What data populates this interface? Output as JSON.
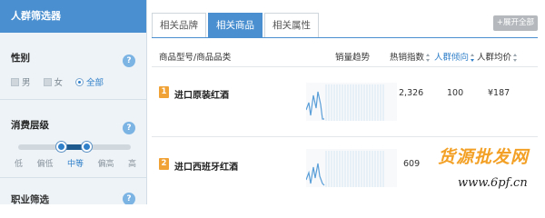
{
  "sidebar": {
    "title": "人群筛选器",
    "gender": {
      "title": "性别",
      "help": "?",
      "options": [
        {
          "label": "男"
        },
        {
          "label": "女"
        },
        {
          "label": "全部",
          "selected": true
        }
      ]
    },
    "consumption": {
      "title": "消费层级",
      "help": "?",
      "levels": [
        "低",
        "偏低",
        "中等",
        "偏高",
        "高"
      ],
      "selected_level": "中等"
    },
    "next_section": {
      "title": "职业筛选",
      "help": "?"
    }
  },
  "tabs": [
    {
      "label": "相关品牌",
      "active": false
    },
    {
      "label": "相关商品",
      "active": true
    },
    {
      "label": "相关属性",
      "active": false
    }
  ],
  "expand_button": "+展开全部",
  "table": {
    "headers": {
      "product": "商品型号/商品品类",
      "trend": "销量趋势",
      "hot_index": "热销指数",
      "crowd_tendency": "人群倾向",
      "avg_price": "人群均价"
    },
    "rows": [
      {
        "rank": "1",
        "name": "进口原装红酒",
        "hot_index": "2,326",
        "crowd_tendency": "100",
        "avg_price": "¥187"
      },
      {
        "rank": "2",
        "name": "进口西班牙红酒",
        "hot_index": "609",
        "crowd_tendency": "",
        "avg_price": ""
      }
    ]
  },
  "watermark": {
    "title": "货源批发网",
    "url": "www.6pf.cn"
  },
  "colors": {
    "accent": "#4a8fd0",
    "rank_badge": "#f0a236",
    "watermark": "#f3a126"
  }
}
